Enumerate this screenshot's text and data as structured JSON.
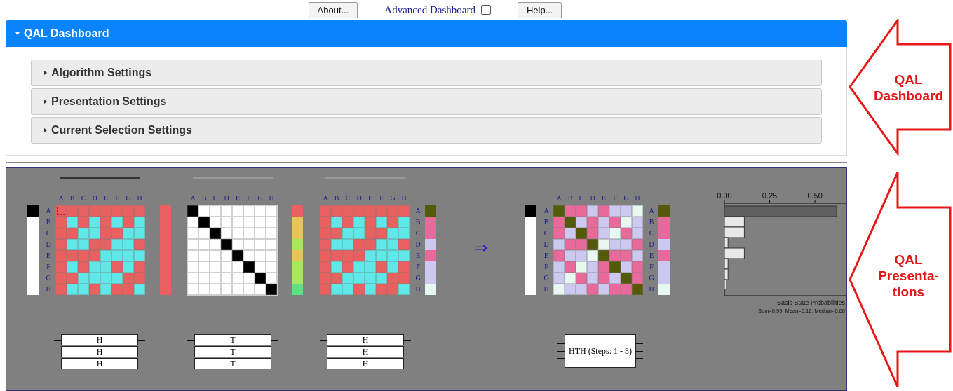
{
  "toolbar": {
    "about": "About...",
    "advanced": {
      "label": "Advanced Dashboard",
      "checked": false
    },
    "help": "Help..."
  },
  "dashboard": {
    "title": "QAL Dashboard",
    "expanded": true,
    "sections": [
      {
        "label": "Algorithm Settings",
        "expanded": false
      },
      {
        "label": "Presentation Settings",
        "expanded": false
      },
      {
        "label": "Current Selection Settings",
        "expanded": false
      }
    ]
  },
  "presentation": {
    "steps": [
      {
        "selected": true,
        "column_labels": [
          "A",
          "B",
          "C",
          "D",
          "E",
          "F",
          "G",
          "H"
        ],
        "row_labels_left": [
          "A",
          "B",
          "C",
          "D",
          "E",
          "F",
          "G",
          "H"
        ],
        "state_bar": [
          {
            "color": "#000000"
          },
          {
            "color": "#ffffff"
          },
          {
            "color": "#ffffff"
          },
          {
            "color": "#ffffff"
          },
          {
            "color": "#ffffff"
          },
          {
            "color": "#ffffff"
          },
          {
            "color": "#ffffff"
          },
          {
            "color": "#ffffff"
          }
        ],
        "matrix": [
          [
            {
              "color": "#e86060"
            },
            {
              "color": "#e86060"
            },
            {
              "color": "#e86060"
            },
            {
              "color": "#e86060"
            },
            {
              "color": "#e86060"
            },
            {
              "color": "#e86060"
            },
            {
              "color": "#e86060"
            },
            {
              "color": "#e86060"
            }
          ],
          [
            {
              "color": "#e86060"
            },
            {
              "color": "#60e8e8"
            },
            {
              "color": "#e86060"
            },
            {
              "color": "#60e8e8"
            },
            {
              "color": "#e86060"
            },
            {
              "color": "#60e8e8"
            },
            {
              "color": "#e86060"
            },
            {
              "color": "#60e8e8"
            }
          ],
          [
            {
              "color": "#e86060"
            },
            {
              "color": "#e86060"
            },
            {
              "color": "#60e8e8"
            },
            {
              "color": "#60e8e8"
            },
            {
              "color": "#e86060"
            },
            {
              "color": "#e86060"
            },
            {
              "color": "#60e8e8"
            },
            {
              "color": "#60e8e8"
            }
          ],
          [
            {
              "color": "#e86060"
            },
            {
              "color": "#60e8e8"
            },
            {
              "color": "#60e8e8"
            },
            {
              "color": "#e86060"
            },
            {
              "color": "#e86060"
            },
            {
              "color": "#60e8e8"
            },
            {
              "color": "#60e8e8"
            },
            {
              "color": "#e86060"
            }
          ],
          [
            {
              "color": "#e86060"
            },
            {
              "color": "#e86060"
            },
            {
              "color": "#e86060"
            },
            {
              "color": "#e86060"
            },
            {
              "color": "#60e8e8"
            },
            {
              "color": "#60e8e8"
            },
            {
              "color": "#60e8e8"
            },
            {
              "color": "#60e8e8"
            }
          ],
          [
            {
              "color": "#e86060"
            },
            {
              "color": "#60e8e8"
            },
            {
              "color": "#e86060"
            },
            {
              "color": "#60e8e8"
            },
            {
              "color": "#60e8e8"
            },
            {
              "color": "#e86060"
            },
            {
              "color": "#60e8e8"
            },
            {
              "color": "#e86060"
            }
          ],
          [
            {
              "color": "#e86060"
            },
            {
              "color": "#e86060"
            },
            {
              "color": "#60e8e8"
            },
            {
              "color": "#60e8e8"
            },
            {
              "color": "#60e8e8"
            },
            {
              "color": "#60e8e8"
            },
            {
              "color": "#e86060"
            },
            {
              "color": "#e86060"
            }
          ],
          [
            {
              "color": "#e86060"
            },
            {
              "color": "#60e8e8"
            },
            {
              "color": "#60e8e8"
            },
            {
              "color": "#e86060"
            },
            {
              "color": "#60e8e8"
            },
            {
              "color": "#e86060"
            },
            {
              "color": "#e86060"
            },
            {
              "color": "#60e8e8"
            }
          ]
        ],
        "cursor": true,
        "side_column": [
          {
            "color": "#e86060"
          },
          {
            "color": "#e86060"
          },
          {
            "color": "#e86060"
          },
          {
            "color": "#e86060"
          },
          {
            "color": "#e86060"
          },
          {
            "color": "#e86060"
          },
          {
            "color": "#e86060"
          },
          {
            "color": "#e86060"
          }
        ],
        "gates": [
          "H",
          "H",
          "H"
        ]
      },
      {
        "selected": false,
        "column_labels": [
          "A",
          "B",
          "C",
          "D",
          "E",
          "F",
          "G",
          "H"
        ],
        "matrix": [
          [
            {
              "color": "#000000"
            },
            {
              "color": "#ffffff"
            },
            {
              "color": "#ffffff"
            },
            {
              "color": "#ffffff"
            },
            {
              "color": "#ffffff"
            },
            {
              "color": "#ffffff"
            },
            {
              "color": "#ffffff"
            },
            {
              "color": "#ffffff"
            }
          ],
          [
            {
              "color": "#ffffff"
            },
            {
              "color": "#000000"
            },
            {
              "color": "#ffffff"
            },
            {
              "color": "#ffffff"
            },
            {
              "color": "#ffffff"
            },
            {
              "color": "#ffffff"
            },
            {
              "color": "#ffffff"
            },
            {
              "color": "#ffffff"
            }
          ],
          [
            {
              "color": "#ffffff"
            },
            {
              "color": "#ffffff"
            },
            {
              "color": "#000000"
            },
            {
              "color": "#ffffff"
            },
            {
              "color": "#ffffff"
            },
            {
              "color": "#ffffff"
            },
            {
              "color": "#ffffff"
            },
            {
              "color": "#ffffff"
            }
          ],
          [
            {
              "color": "#ffffff"
            },
            {
              "color": "#ffffff"
            },
            {
              "color": "#ffffff"
            },
            {
              "color": "#000000"
            },
            {
              "color": "#ffffff"
            },
            {
              "color": "#ffffff"
            },
            {
              "color": "#ffffff"
            },
            {
              "color": "#ffffff"
            }
          ],
          [
            {
              "color": "#ffffff"
            },
            {
              "color": "#ffffff"
            },
            {
              "color": "#ffffff"
            },
            {
              "color": "#ffffff"
            },
            {
              "color": "#000000"
            },
            {
              "color": "#ffffff"
            },
            {
              "color": "#ffffff"
            },
            {
              "color": "#ffffff"
            }
          ],
          [
            {
              "color": "#ffffff"
            },
            {
              "color": "#ffffff"
            },
            {
              "color": "#ffffff"
            },
            {
              "color": "#ffffff"
            },
            {
              "color": "#ffffff"
            },
            {
              "color": "#000000"
            },
            {
              "color": "#ffffff"
            },
            {
              "color": "#ffffff"
            }
          ],
          [
            {
              "color": "#ffffff"
            },
            {
              "color": "#ffffff"
            },
            {
              "color": "#ffffff"
            },
            {
              "color": "#ffffff"
            },
            {
              "color": "#ffffff"
            },
            {
              "color": "#ffffff"
            },
            {
              "color": "#000000"
            },
            {
              "color": "#ffffff"
            }
          ],
          [
            {
              "color": "#ffffff"
            },
            {
              "color": "#ffffff"
            },
            {
              "color": "#ffffff"
            },
            {
              "color": "#ffffff"
            },
            {
              "color": "#ffffff"
            },
            {
              "color": "#ffffff"
            },
            {
              "color": "#ffffff"
            },
            {
              "color": "#000000"
            }
          ]
        ],
        "side_column": [
          {
            "color": "#e86060"
          },
          {
            "color": "#e8c460"
          },
          {
            "color": "#e8c460"
          },
          {
            "color": "#a8e860"
          },
          {
            "color": "#e8c460"
          },
          {
            "color": "#a8e860"
          },
          {
            "color": "#a8e860"
          },
          {
            "color": "#60e080"
          }
        ],
        "gates": [
          "T",
          "T",
          "T"
        ]
      },
      {
        "selected": false,
        "column_labels": [
          "A",
          "B",
          "C",
          "D",
          "E",
          "F",
          "G",
          "H"
        ],
        "row_labels_right": [
          "A",
          "B",
          "C",
          "D",
          "E",
          "F",
          "G",
          "H"
        ],
        "matrix": [
          [
            {
              "color": "#e86060"
            },
            {
              "color": "#e86060"
            },
            {
              "color": "#e86060"
            },
            {
              "color": "#e86060"
            },
            {
              "color": "#e86060"
            },
            {
              "color": "#e86060"
            },
            {
              "color": "#e86060"
            },
            {
              "color": "#e86060"
            }
          ],
          [
            {
              "color": "#e86060"
            },
            {
              "color": "#60e8e8"
            },
            {
              "color": "#e86060"
            },
            {
              "color": "#60e8e8"
            },
            {
              "color": "#e86060"
            },
            {
              "color": "#60e8e8"
            },
            {
              "color": "#e86060"
            },
            {
              "color": "#60e8e8"
            }
          ],
          [
            {
              "color": "#e86060"
            },
            {
              "color": "#e86060"
            },
            {
              "color": "#60e8e8"
            },
            {
              "color": "#60e8e8"
            },
            {
              "color": "#e86060"
            },
            {
              "color": "#e86060"
            },
            {
              "color": "#60e8e8"
            },
            {
              "color": "#60e8e8"
            }
          ],
          [
            {
              "color": "#e86060"
            },
            {
              "color": "#60e8e8"
            },
            {
              "color": "#60e8e8"
            },
            {
              "color": "#e86060"
            },
            {
              "color": "#e86060"
            },
            {
              "color": "#60e8e8"
            },
            {
              "color": "#60e8e8"
            },
            {
              "color": "#e86060"
            }
          ],
          [
            {
              "color": "#e86060"
            },
            {
              "color": "#e86060"
            },
            {
              "color": "#e86060"
            },
            {
              "color": "#e86060"
            },
            {
              "color": "#60e8e8"
            },
            {
              "color": "#60e8e8"
            },
            {
              "color": "#60e8e8"
            },
            {
              "color": "#60e8e8"
            }
          ],
          [
            {
              "color": "#e86060"
            },
            {
              "color": "#60e8e8"
            },
            {
              "color": "#e86060"
            },
            {
              "color": "#60e8e8"
            },
            {
              "color": "#60e8e8"
            },
            {
              "color": "#e86060"
            },
            {
              "color": "#60e8e8"
            },
            {
              "color": "#e86060"
            }
          ],
          [
            {
              "color": "#e86060"
            },
            {
              "color": "#e86060"
            },
            {
              "color": "#60e8e8"
            },
            {
              "color": "#60e8e8"
            },
            {
              "color": "#60e8e8"
            },
            {
              "color": "#60e8e8"
            },
            {
              "color": "#e86060"
            },
            {
              "color": "#e86060"
            }
          ],
          [
            {
              "color": "#e86060"
            },
            {
              "color": "#60e8e8"
            },
            {
              "color": "#60e8e8"
            },
            {
              "color": "#e86060"
            },
            {
              "color": "#60e8e8"
            },
            {
              "color": "#e86060"
            },
            {
              "color": "#e86060"
            },
            {
              "color": "#60e8e8"
            }
          ]
        ],
        "side_column": [
          {
            "color": "#555a0a"
          },
          {
            "color": "#e86a9a"
          },
          {
            "color": "#e86a9a"
          },
          {
            "color": "#ccc8f0"
          },
          {
            "color": "#e86a9a"
          },
          {
            "color": "#ccc8f0"
          },
          {
            "color": "#ccc8f0"
          },
          {
            "color": "#e8f8f0"
          }
        ],
        "gates": [
          "H",
          "H",
          "H"
        ]
      }
    ],
    "arrow": "⇒",
    "result": {
      "column_labels": [
        "A",
        "B",
        "C",
        "D",
        "E",
        "F",
        "G",
        "H"
      ],
      "row_labels_left": [
        "A",
        "B",
        "C",
        "D",
        "E",
        "F",
        "G",
        "H"
      ],
      "row_labels_right": [
        "A",
        "B",
        "C",
        "D",
        "E",
        "F",
        "G",
        "H"
      ],
      "state_bar": [
        {
          "color": "#000000"
        },
        {
          "color": "#ffffff"
        },
        {
          "color": "#ffffff"
        },
        {
          "color": "#ffffff"
        },
        {
          "color": "#ffffff"
        },
        {
          "color": "#ffffff"
        },
        {
          "color": "#ffffff"
        },
        {
          "color": "#ffffff"
        }
      ],
      "matrix": [
        [
          {
            "color": "#555a0a"
          },
          {
            "color": "#e86a9a"
          },
          {
            "color": "#e86a9a"
          },
          {
            "color": "#ccc8f0"
          },
          {
            "color": "#e86a9a"
          },
          {
            "color": "#ccc8f0"
          },
          {
            "color": "#ccc8f0"
          },
          {
            "color": "#e8f8f0"
          }
        ],
        [
          {
            "color": "#e86a9a"
          },
          {
            "color": "#555a0a"
          },
          {
            "color": "#ccc8f0"
          },
          {
            "color": "#e86a9a"
          },
          {
            "color": "#ccc8f0"
          },
          {
            "color": "#e86a9a"
          },
          {
            "color": "#e8f8f0"
          },
          {
            "color": "#ccc8f0"
          }
        ],
        [
          {
            "color": "#e86a9a"
          },
          {
            "color": "#ccc8f0"
          },
          {
            "color": "#555a0a"
          },
          {
            "color": "#e86a9a"
          },
          {
            "color": "#ccc8f0"
          },
          {
            "color": "#e8f8f0"
          },
          {
            "color": "#e86a9a"
          },
          {
            "color": "#ccc8f0"
          }
        ],
        [
          {
            "color": "#ccc8f0"
          },
          {
            "color": "#e86a9a"
          },
          {
            "color": "#e86a9a"
          },
          {
            "color": "#555a0a"
          },
          {
            "color": "#e8f8f0"
          },
          {
            "color": "#ccc8f0"
          },
          {
            "color": "#ccc8f0"
          },
          {
            "color": "#e86a9a"
          }
        ],
        [
          {
            "color": "#e86a9a"
          },
          {
            "color": "#ccc8f0"
          },
          {
            "color": "#ccc8f0"
          },
          {
            "color": "#e8f8f0"
          },
          {
            "color": "#555a0a"
          },
          {
            "color": "#e86a9a"
          },
          {
            "color": "#e86a9a"
          },
          {
            "color": "#ccc8f0"
          }
        ],
        [
          {
            "color": "#ccc8f0"
          },
          {
            "color": "#e86a9a"
          },
          {
            "color": "#e8f8f0"
          },
          {
            "color": "#ccc8f0"
          },
          {
            "color": "#e86a9a"
          },
          {
            "color": "#555a0a"
          },
          {
            "color": "#ccc8f0"
          },
          {
            "color": "#e86a9a"
          }
        ],
        [
          {
            "color": "#ccc8f0"
          },
          {
            "color": "#e8f8f0"
          },
          {
            "color": "#e86a9a"
          },
          {
            "color": "#ccc8f0"
          },
          {
            "color": "#e86a9a"
          },
          {
            "color": "#ccc8f0"
          },
          {
            "color": "#555a0a"
          },
          {
            "color": "#e86a9a"
          }
        ],
        [
          {
            "color": "#e8f8f0"
          },
          {
            "color": "#ccc8f0"
          },
          {
            "color": "#ccc8f0"
          },
          {
            "color": "#e86a9a"
          },
          {
            "color": "#ccc8f0"
          },
          {
            "color": "#e86a9a"
          },
          {
            "color": "#e86a9a"
          },
          {
            "color": "#555a0a"
          }
        ]
      ],
      "side_column": [
        {
          "color": "#555a0a"
        },
        {
          "color": "#e86a9a"
        },
        {
          "color": "#e86a9a"
        },
        {
          "color": "#ccc8f0"
        },
        {
          "color": "#e86a9a"
        },
        {
          "color": "#ccc8f0"
        },
        {
          "color": "#ccc8f0"
        },
        {
          "color": "#e8f8f0"
        }
      ],
      "circuit": "HTH (Steps: 1 - 3)"
    },
    "chart_data": {
      "type": "bar",
      "orientation": "horizontal",
      "title": "Basis State Probabilities",
      "subtitle": "Sum=0.99, Mean=0.12, Median=0.06",
      "series": [
        {
          "color": "#606060",
          "values": [
            0.62,
            null,
            null,
            null,
            null,
            null,
            null,
            null
          ]
        },
        {
          "color": "#e8e8e8",
          "values": [
            null,
            0.11,
            0.11,
            0.02,
            0.11,
            0.02,
            0.02,
            0.01
          ]
        }
      ],
      "xlim": [
        0,
        0.67
      ],
      "xticks": [
        {
          "value": 0,
          "label": "0.00"
        },
        {
          "value": 0.25,
          "label": "0.25"
        },
        {
          "value": 0.5,
          "label": "0.50"
        }
      ]
    }
  },
  "annotations": [
    {
      "lines": [
        "QAL",
        "Dashboard"
      ]
    },
    {
      "lines": [
        "QAL",
        "Presenta-",
        "tions"
      ]
    }
  ]
}
